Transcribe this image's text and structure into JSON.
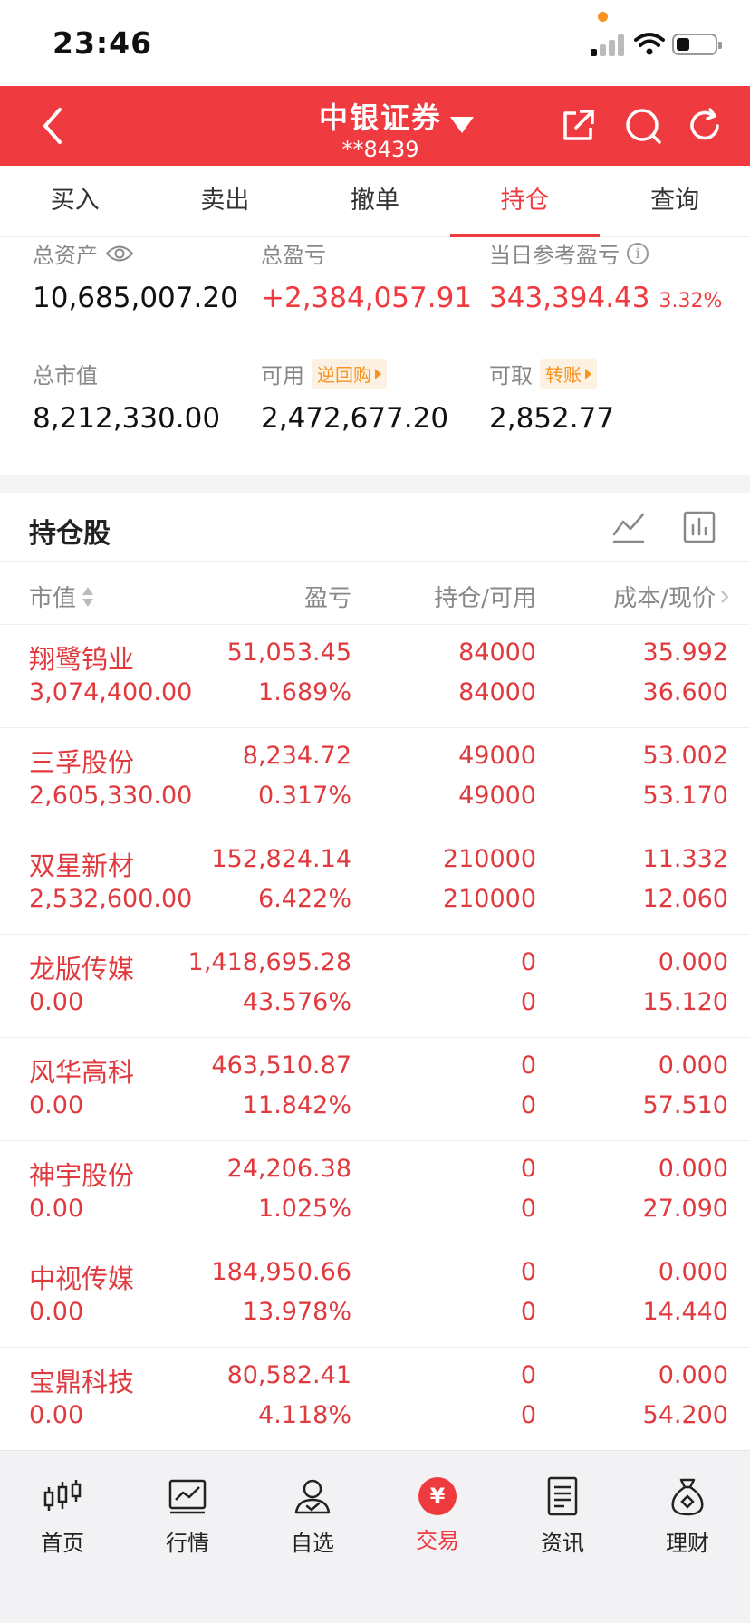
{
  "status": {
    "time": "23:46"
  },
  "header": {
    "title": "中银证券",
    "account": "**8439"
  },
  "tabs": [
    "买入",
    "卖出",
    "撤单",
    "持仓",
    "查询"
  ],
  "active_tab": "持仓",
  "summary": {
    "total_assets_label": "总资产",
    "total_assets": "10,685,007.20",
    "total_pnl_label": "总盈亏",
    "total_pnl": "+2,384,057.91",
    "daily_pnl_label": "当日参考盈亏",
    "daily_pnl": "343,394.43",
    "daily_pnl_pct": "3.32%",
    "market_value_label": "总市值",
    "market_value": "8,212,330.00",
    "available_label": "可用",
    "available_tag": "逆回购",
    "available": "2,472,677.20",
    "withdrawable_label": "可取",
    "withdrawable_tag": "转账",
    "withdrawable": "2,852.77"
  },
  "holdings": {
    "title": "持仓股",
    "columns": {
      "market_value": "市值",
      "pnl": "盈亏",
      "position": "持仓/可用",
      "cost_price": "成本/现价"
    },
    "rows": [
      {
        "name": "翔鹭钨业",
        "market_value": "3,074,400.00",
        "pnl": "51,053.45",
        "pnl_pct": "1.689%",
        "position": "84000",
        "available": "84000",
        "cost": "35.992",
        "price": "36.600"
      },
      {
        "name": "三孚股份",
        "market_value": "2,605,330.00",
        "pnl": "8,234.72",
        "pnl_pct": "0.317%",
        "position": "49000",
        "available": "49000",
        "cost": "53.002",
        "price": "53.170"
      },
      {
        "name": "双星新材",
        "market_value": "2,532,600.00",
        "pnl": "152,824.14",
        "pnl_pct": "6.422%",
        "position": "210000",
        "available": "210000",
        "cost": "11.332",
        "price": "12.060"
      },
      {
        "name": "龙版传媒",
        "market_value": "0.00",
        "pnl": "1,418,695.28",
        "pnl_pct": "43.576%",
        "position": "0",
        "available": "0",
        "cost": "0.000",
        "price": "15.120"
      },
      {
        "name": "风华高科",
        "market_value": "0.00",
        "pnl": "463,510.87",
        "pnl_pct": "11.842%",
        "position": "0",
        "available": "0",
        "cost": "0.000",
        "price": "57.510"
      },
      {
        "name": "神宇股份",
        "market_value": "0.00",
        "pnl": "24,206.38",
        "pnl_pct": "1.025%",
        "position": "0",
        "available": "0",
        "cost": "0.000",
        "price": "27.090"
      },
      {
        "name": "中视传媒",
        "market_value": "0.00",
        "pnl": "184,950.66",
        "pnl_pct": "13.978%",
        "position": "0",
        "available": "0",
        "cost": "0.000",
        "price": "14.440"
      },
      {
        "name": "宝鼎科技",
        "market_value": "0.00",
        "pnl": "80,582.41",
        "pnl_pct": "4.118%",
        "position": "0",
        "available": "0",
        "cost": "0.000",
        "price": "54.200"
      }
    ]
  },
  "bottom_nav": [
    {
      "label": "首页",
      "icon": "candlestick-icon"
    },
    {
      "label": "行情",
      "icon": "chart-icon"
    },
    {
      "label": "自选",
      "icon": "user-check-icon"
    },
    {
      "label": "交易",
      "icon": "yen-icon",
      "glyph": "¥"
    },
    {
      "label": "资讯",
      "icon": "document-icon"
    },
    {
      "label": "理财",
      "icon": "money-bag-icon"
    }
  ],
  "colors": {
    "accent": "#ef3a3f",
    "tag": "#f7931e",
    "text_red": "#e03a3e"
  }
}
